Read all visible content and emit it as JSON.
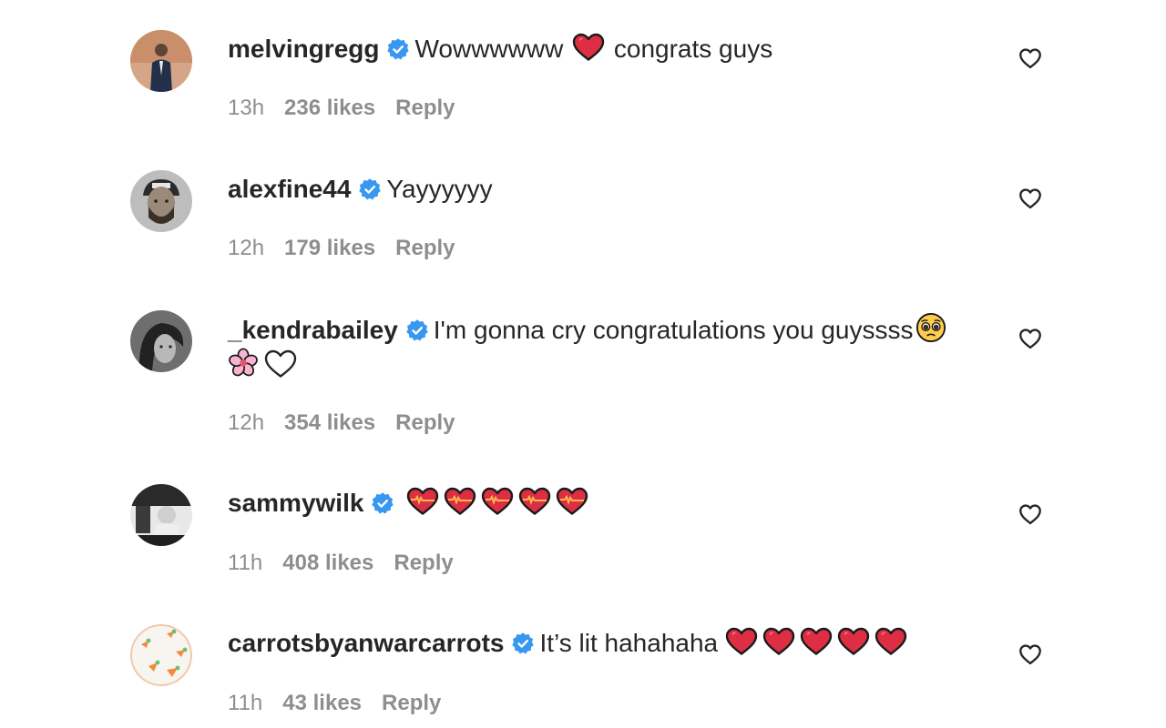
{
  "comments": [
    {
      "username": "melvingregg",
      "verified": true,
      "text": "Wowwwwww",
      "text_after": "congrats guys",
      "emoji": [
        "red-heart"
      ],
      "time": "13h",
      "likes": "236 likes",
      "reply": "Reply"
    },
    {
      "username": "alexfine44",
      "verified": true,
      "text": "Yayyyyyy",
      "time": "12h",
      "likes": "179 likes",
      "reply": "Reply"
    },
    {
      "username": "_kendrabailey",
      "verified": true,
      "text": "I'm gonna cry congratulations you guyssss",
      "emoji": [
        "pleading-face",
        "cherry-blossom",
        "white-heart"
      ],
      "time": "12h",
      "likes": "354 likes",
      "reply": "Reply"
    },
    {
      "username": "sammywilk",
      "verified": true,
      "text": "",
      "emoji": [
        "heart-on-fire",
        "heart-on-fire",
        "heart-on-fire",
        "heart-on-fire",
        "heart-on-fire"
      ],
      "time": "11h",
      "likes": "408 likes",
      "reply": "Reply"
    },
    {
      "username": "carrotsbyanwarcarrots",
      "verified": true,
      "text": "It’s lit hahahaha",
      "emoji": [
        "red-heart",
        "red-heart",
        "red-heart",
        "red-heart",
        "red-heart"
      ],
      "time": "11h",
      "likes": "43 likes",
      "reply": "Reply"
    }
  ],
  "colors": {
    "text": "#262626",
    "meta": "#8e8e8e",
    "verified": "#3897f0",
    "heart": "#e0245e"
  }
}
